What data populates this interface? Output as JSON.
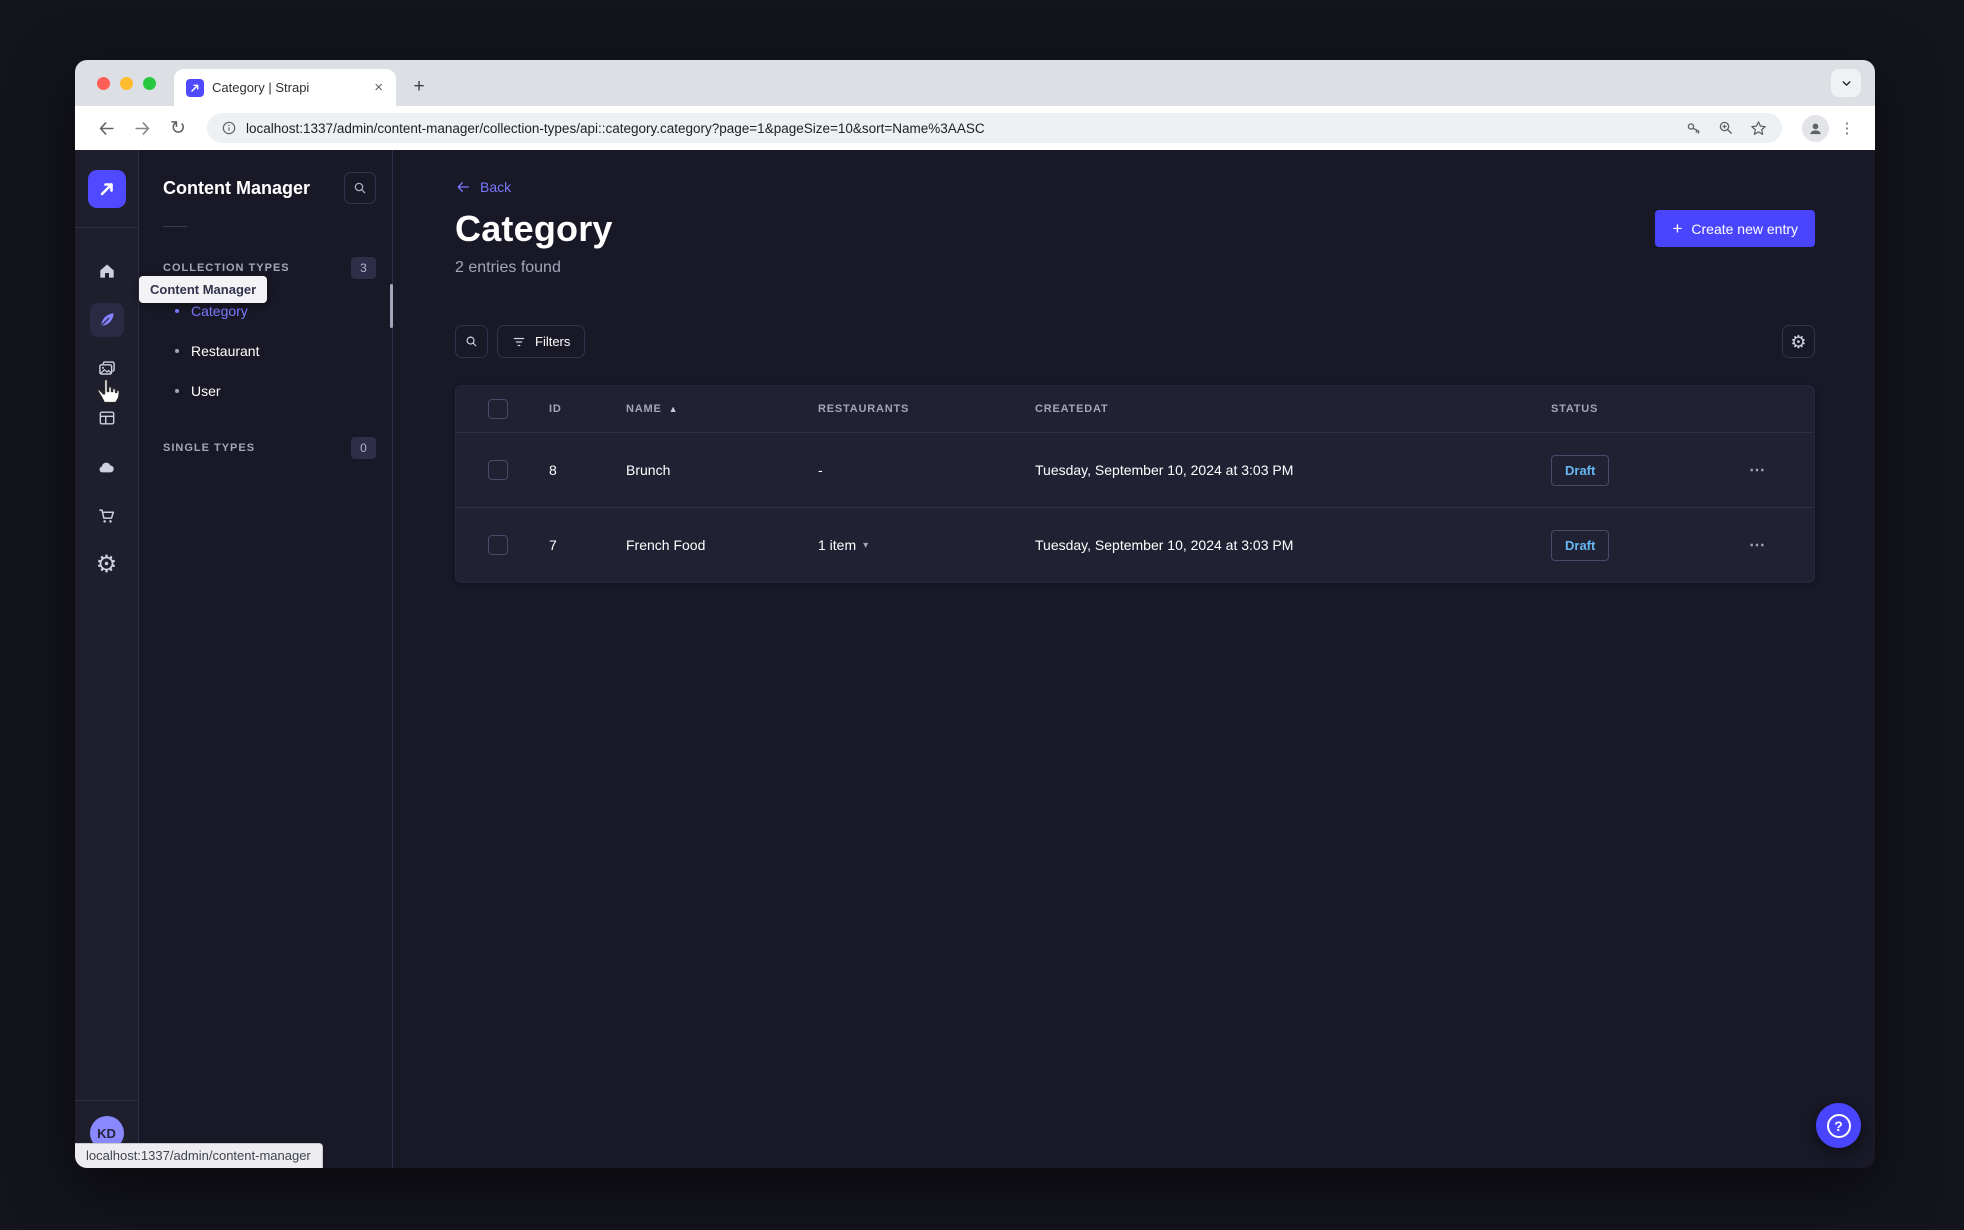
{
  "browser": {
    "tab": {
      "title": "Category | Strapi",
      "close_glyph": "×"
    },
    "new_tab_glyph": "+",
    "reload_glyph": "↻",
    "kebab_glyph": "⋮",
    "url": "localhost:1337/admin/content-manager/collection-types/api::category.category?page=1&pageSize=10&sort=Name%3AASC",
    "status_bar": "localhost:1337/admin/content-manager"
  },
  "sidebar": {
    "tooltip": "Content Manager",
    "icons": [
      "home",
      "content-manager",
      "media-library",
      "content-type-builder",
      "cloud",
      "marketplace",
      "settings"
    ],
    "settings_glyph": "⚙",
    "avatar_initials": "KD"
  },
  "subnav": {
    "title": "Content Manager",
    "sections": [
      {
        "label": "COLLECTION TYPES",
        "badge": "3",
        "items": [
          {
            "label": "Category",
            "active": true
          },
          {
            "label": "Restaurant",
            "active": false
          },
          {
            "label": "User",
            "active": false
          }
        ]
      },
      {
        "label": "SINGLE TYPES",
        "badge": "0",
        "items": []
      }
    ]
  },
  "main": {
    "back_label": "Back",
    "title": "Category",
    "subtitle": "2 entries found",
    "create_button": "Create new entry",
    "create_plus_glyph": "+",
    "filters_button": "Filters",
    "settings_glyph": "⚙",
    "table": {
      "headers": [
        "ID",
        "NAME",
        "RESTAURANTS",
        "CREATEDAT",
        "STATUS"
      ],
      "sort_asc_glyph": "▲",
      "caret_down_glyph": "▾",
      "more_glyph": "⋯",
      "rows": [
        {
          "id": "8",
          "name": "Brunch",
          "restaurants": "-",
          "created_at": "Tuesday, September 10, 2024 at 3:03 PM",
          "status": "Draft"
        },
        {
          "id": "7",
          "name": "French Food",
          "restaurants": "1 item",
          "created_at": "Tuesday, September 10, 2024 at 3:03 PM",
          "status": "Draft"
        }
      ]
    },
    "help_glyph": "?"
  },
  "colors": {
    "primary": "#4945ff",
    "primary_light": "#7b79ff",
    "draft_text": "#66b7f1",
    "app_bg": "#181826",
    "panel_bg": "#212134"
  }
}
